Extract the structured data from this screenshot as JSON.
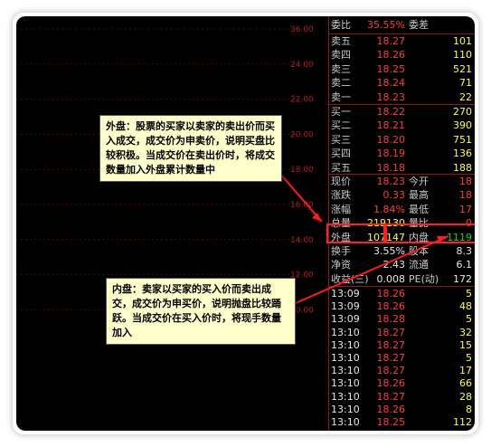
{
  "chart": {
    "price_labels": [
      "36.00",
      "24.00",
      "22.00",
      "20.00",
      "18.00",
      "16.00",
      "14.00",
      "12.00",
      "10.00"
    ]
  },
  "quote": {
    "weibi_label": "委比",
    "weibi_value": "35.55%",
    "weicha_label": "委差",
    "weicha_value": "",
    "sell": [
      {
        "label": "卖五",
        "price": "18.27",
        "vol": "101"
      },
      {
        "label": "卖四",
        "price": "18.26",
        "vol": "110"
      },
      {
        "label": "卖三",
        "price": "18.25",
        "vol": "521"
      },
      {
        "label": "卖二",
        "price": "18.24",
        "vol": "71"
      },
      {
        "label": "卖一",
        "price": "18.23",
        "vol": "22"
      }
    ],
    "buy": [
      {
        "label": "买一",
        "price": "18.22",
        "vol": "270"
      },
      {
        "label": "买二",
        "price": "18.21",
        "vol": "390"
      },
      {
        "label": "买三",
        "price": "18.20",
        "vol": "751"
      },
      {
        "label": "买四",
        "price": "18.19",
        "vol": "136"
      },
      {
        "label": "买五",
        "price": "18.18",
        "vol": "188"
      }
    ],
    "stats": [
      {
        "l1": "现价",
        "v1": "18.23",
        "l2": "今开",
        "v2": "18"
      },
      {
        "l1": "涨跌",
        "v1": "0.33",
        "l2": "最高",
        "v2": "18"
      },
      {
        "l1": "涨幅",
        "v1": "1.84%",
        "l2": "最低",
        "v2": "17"
      },
      {
        "l1": "总量",
        "v1": "219130",
        "l2": "量比",
        "v2": "0"
      },
      {
        "l1": "外盘",
        "v1": "107147",
        "l2": "内盘",
        "v2": "1119"
      },
      {
        "l1": "换手",
        "v1": "3.55%",
        "l2": "股本",
        "v2": "8.3"
      },
      {
        "l1": "净资",
        "v1": "2.43",
        "l2": "流通",
        "v2": "6.1"
      },
      {
        "l1": "收益(三)",
        "v1": "0.008",
        "l2": "PE(动)",
        "v2": "172"
      }
    ],
    "ticks": [
      {
        "time": "13:09",
        "price": "18.26",
        "vol": "5"
      },
      {
        "time": "13:09",
        "price": "18.26",
        "vol": "48"
      },
      {
        "time": "13:09",
        "price": "18.28",
        "vol": "5"
      },
      {
        "time": "13:10",
        "price": "18.27",
        "vol": "32"
      },
      {
        "time": "13:10",
        "price": "18.27",
        "vol": "15"
      },
      {
        "time": "13:10",
        "price": "18.27",
        "vol": "5"
      },
      {
        "time": "13:10",
        "price": "18.27",
        "vol": "17"
      },
      {
        "time": "13:10",
        "price": "18.26",
        "vol": "66"
      },
      {
        "time": "13:10",
        "price": "18.27",
        "vol": "28"
      },
      {
        "time": "13:10",
        "price": "18.26",
        "vol": "8"
      },
      {
        "time": "13:10",
        "price": "18.25",
        "vol": "112"
      }
    ]
  },
  "callouts": {
    "outer": "外盘：股票的买家以卖家的卖出价而买入成交，成交价为申卖价，说明买盘比较积极。当成交价在卖出价时，将成交数量加入外盘累计数量中",
    "inner": "内盘：卖家以买家的买入价而卖出成交，成交价为申买价，说明抛盘比较踊跃。当成交价在买入价时，将现手数量加入"
  }
}
